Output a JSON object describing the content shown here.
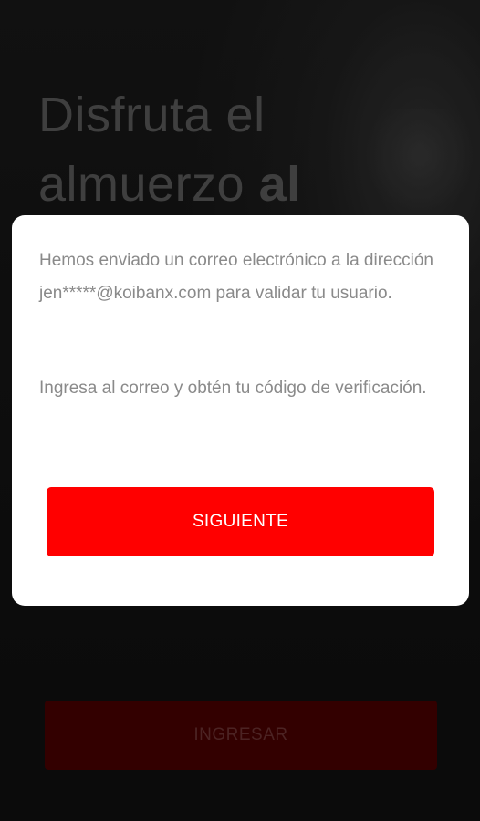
{
  "background": {
    "title_line1": "Disfruta el",
    "title_line2_regular": "almuerzo ",
    "title_line2_bold": "al",
    "login_button_label": "INGRESAR"
  },
  "dialog": {
    "message_line1": "Hemos enviado un correo electrónico a la dirección jen*****@koibanx.com para validar tu usuario.",
    "message_line2": "Ingresa al correo y obtén tu código de verificación.",
    "next_button_label": "SIGUIENTE"
  },
  "colors": {
    "primary": "#ff0000",
    "dialog_text": "#8a8a8a"
  }
}
